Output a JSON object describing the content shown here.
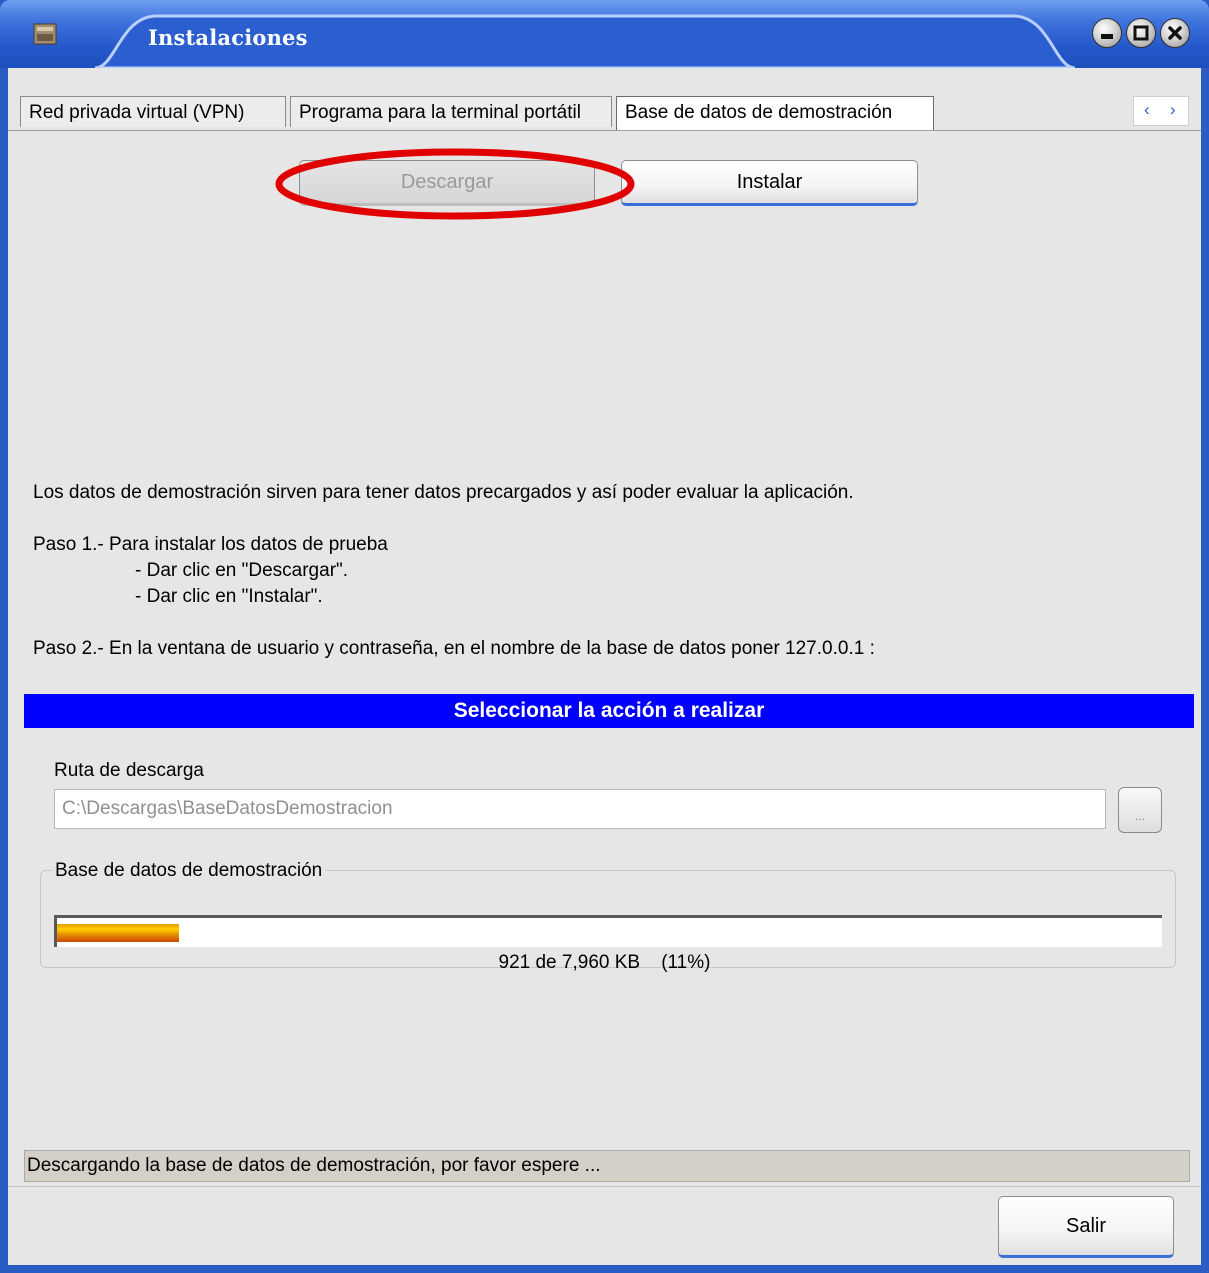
{
  "window": {
    "title": "Instalaciones",
    "app_icon": "app-icon",
    "controls": [
      "minimize-icon",
      "maximize-icon",
      "close-icon"
    ]
  },
  "tabs": [
    {
      "label": "Red privada virtual (VPN)",
      "active": false
    },
    {
      "label": "Programa para la terminal portátil",
      "active": false
    },
    {
      "label": "Base de datos de demostración",
      "active": true
    }
  ],
  "tab_scroll": {
    "left": "‹",
    "right": "›"
  },
  "actions": {
    "download_label": "Descargar",
    "download_enabled": false,
    "install_label": "Instalar"
  },
  "description": {
    "intro": "Los datos de demostración sirven para tener datos precargados y así poder evaluar la aplicación.",
    "step1_title": "Paso 1.- Para instalar los datos de prueba",
    "step1_a": "- Dar clic en \"Descargar\".",
    "step1_b": "- Dar clic en \"Instalar\".",
    "step2": "Paso 2.- En la ventana de usuario y contraseña, en el nombre de la base de datos poner 127.0.0.1 :"
  },
  "section_title": "Seleccionar la acción a realizar",
  "download_path": {
    "label": "Ruta de descarga",
    "value": "C:\\Descargas\\BaseDatosDemostracion",
    "browse_label": "..."
  },
  "progress": {
    "group_label": "Base de datos de demostración",
    "fraction": 0.11,
    "text": "921 de 7,960 KB    (11%)"
  },
  "status_text": "Descargando la base de datos de demostración, por favor espere ...",
  "exit_label": "Salir",
  "colors": {
    "titlebar": "#2457c9",
    "section_bar": "#0000ff",
    "highlight": "#e00000",
    "progress": "#e08000"
  }
}
